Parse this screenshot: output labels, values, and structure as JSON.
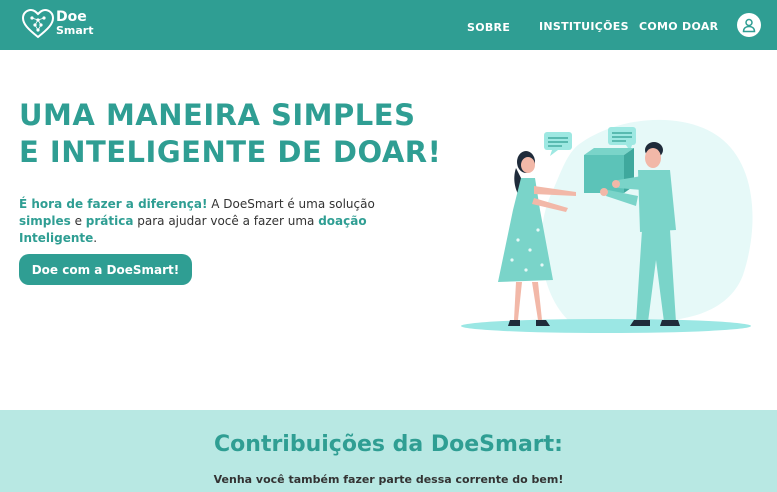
{
  "header": {
    "logo_line1": "Doe",
    "logo_line2": "Smart",
    "nav": {
      "sobre": "SOBRE",
      "instituicoes": "INSTITUIÇÕES",
      "como_doar": "COMO DOAR"
    },
    "user_icon": "user-icon"
  },
  "hero": {
    "title_line1": "UMA MANEIRA SIMPLES",
    "title_line2": "E INTELIGENTE DE DOAR!",
    "desc": {
      "p1": "É hora de fazer a diferença!",
      "p2": " A DoeSmart é uma solução ",
      "p3": "simples",
      "p4": " e ",
      "p5": "prática",
      "p6": " para ajudar você a fazer uma ",
      "p7": "doação Inteligente",
      "p8": "."
    },
    "cta_label": "Doe com  a DoeSmart!"
  },
  "contributions": {
    "title": "Contribuições da DoeSmart:",
    "subtitle": "Venha você também fazer parte dessa corrente do bem!"
  },
  "colors": {
    "primary": "#2f9e93",
    "light": "#b8e8e3",
    "illustration_bg": "#e6f9f8"
  }
}
